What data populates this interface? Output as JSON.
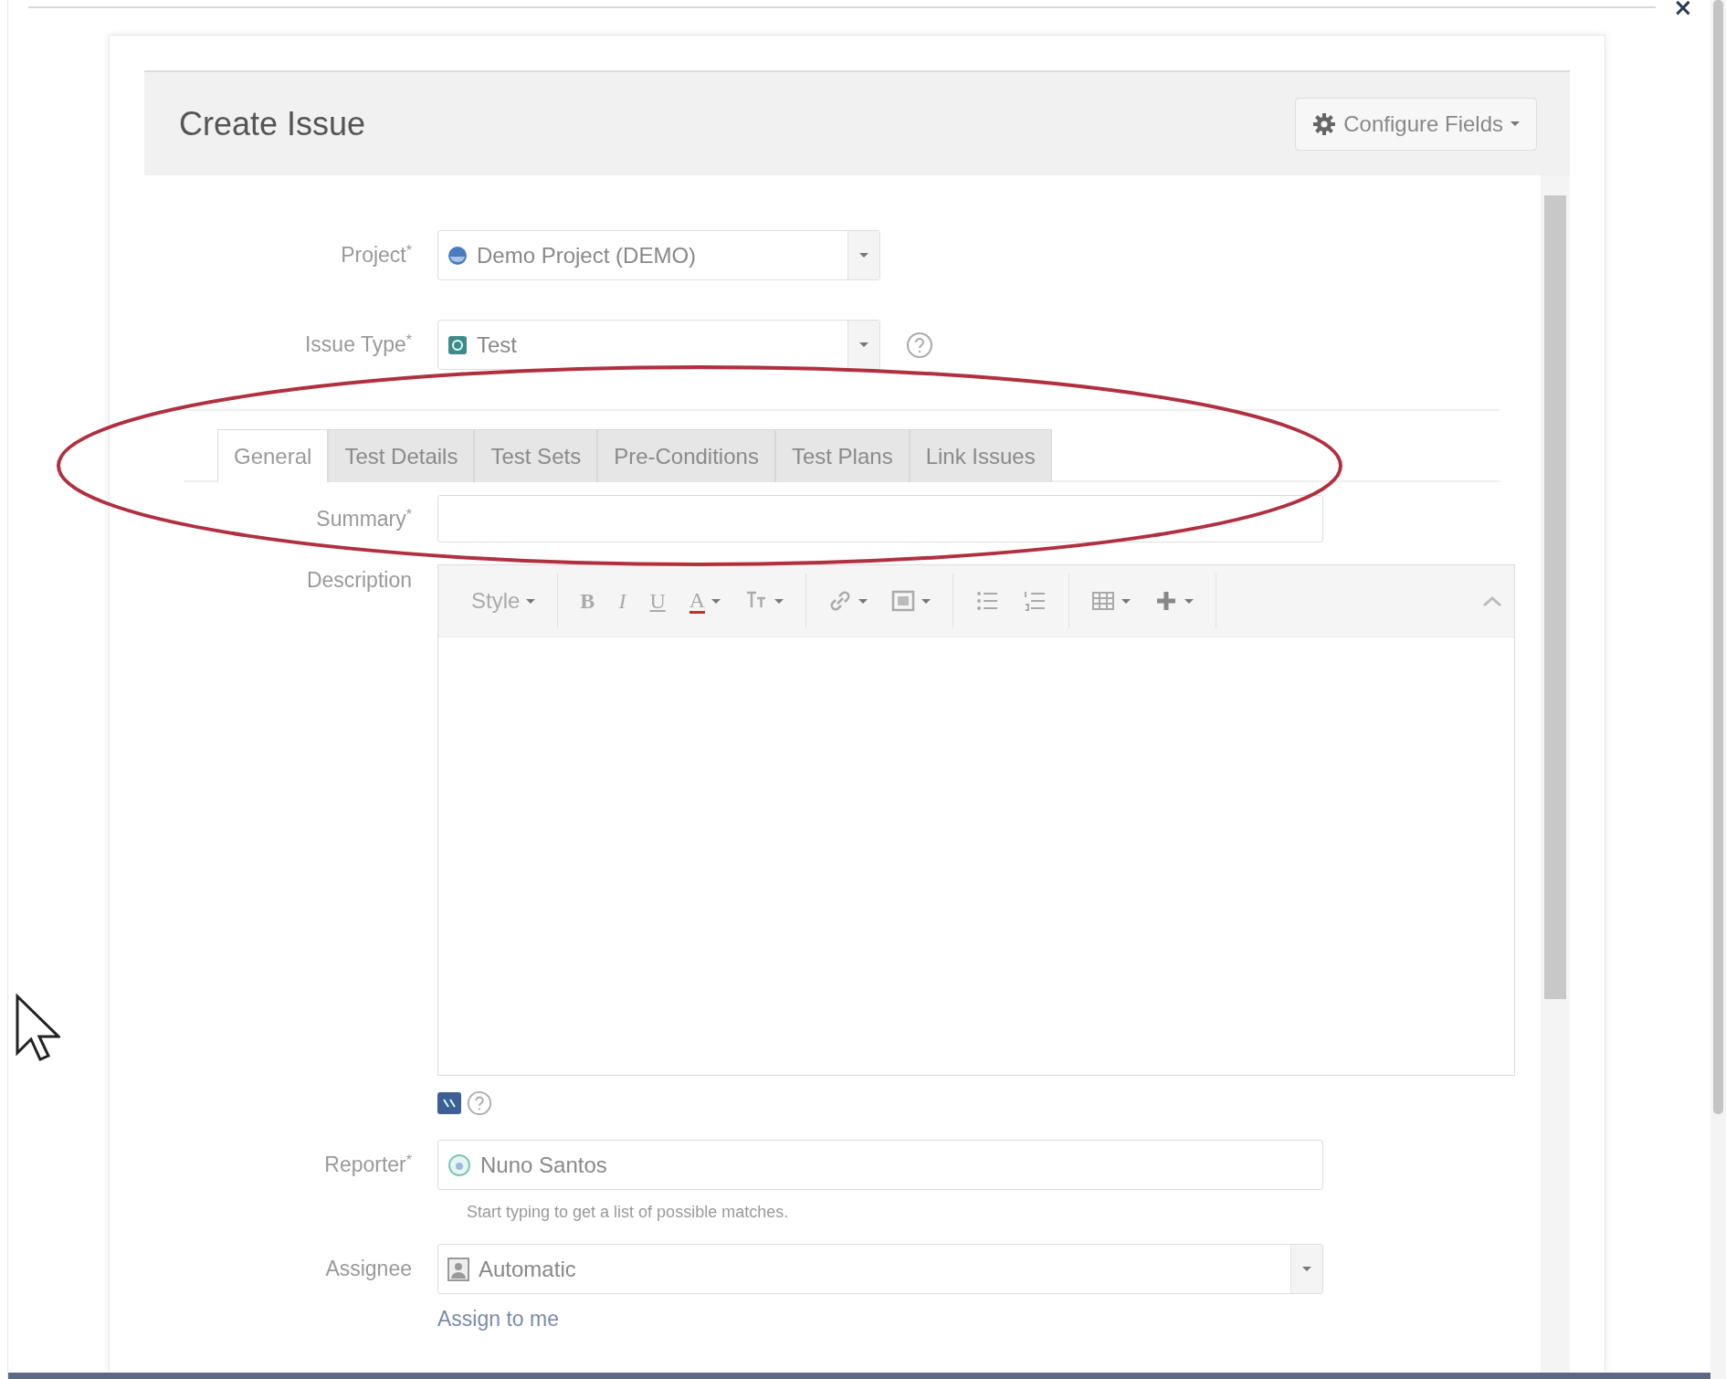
{
  "close": "×",
  "dialog": {
    "title": "Create Issue",
    "configure_button": "Configure Fields"
  },
  "project": {
    "label": "Project",
    "required_mark": "*",
    "value": "Demo Project (DEMO)"
  },
  "issue_type": {
    "label": "Issue Type",
    "required_mark": "*",
    "value": "Test"
  },
  "tabs": [
    {
      "label": "General",
      "selected": true
    },
    {
      "label": "Test Details",
      "selected": false
    },
    {
      "label": "Test Sets",
      "selected": false
    },
    {
      "label": "Pre-Conditions",
      "selected": false
    },
    {
      "label": "Test Plans",
      "selected": false
    },
    {
      "label": "Link Issues",
      "selected": false
    }
  ],
  "summary": {
    "label": "Summary",
    "required_mark": "*"
  },
  "description": {
    "label": "Description",
    "toolbar": [
      [
        {
          "kind": "text",
          "label": "Style",
          "dropdown": true
        }
      ],
      [
        {
          "kind": "bold",
          "label": "B",
          "dropdown": false
        },
        {
          "kind": "italic",
          "label": "I",
          "dropdown": false
        },
        {
          "kind": "underline",
          "label": "U",
          "dropdown": false
        },
        {
          "kind": "color",
          "label": "A",
          "dropdown": true
        },
        {
          "kind": "size",
          "dropdown": true
        }
      ],
      [
        {
          "kind": "link",
          "dropdown": true
        },
        {
          "kind": "image",
          "dropdown": true
        }
      ],
      [
        {
          "kind": "bullets",
          "dropdown": false
        },
        {
          "kind": "numbers",
          "dropdown": false
        }
      ],
      [
        {
          "kind": "table",
          "dropdown": true
        },
        {
          "kind": "plus",
          "dropdown": true
        }
      ]
    ]
  },
  "reporter": {
    "label": "Reporter",
    "required_mark": "*",
    "value": "Nuno Santos",
    "hint": "Start typing to get a list of possible matches."
  },
  "assignee": {
    "label": "Assignee",
    "value": "Automatic",
    "link": "Assign to me"
  }
}
